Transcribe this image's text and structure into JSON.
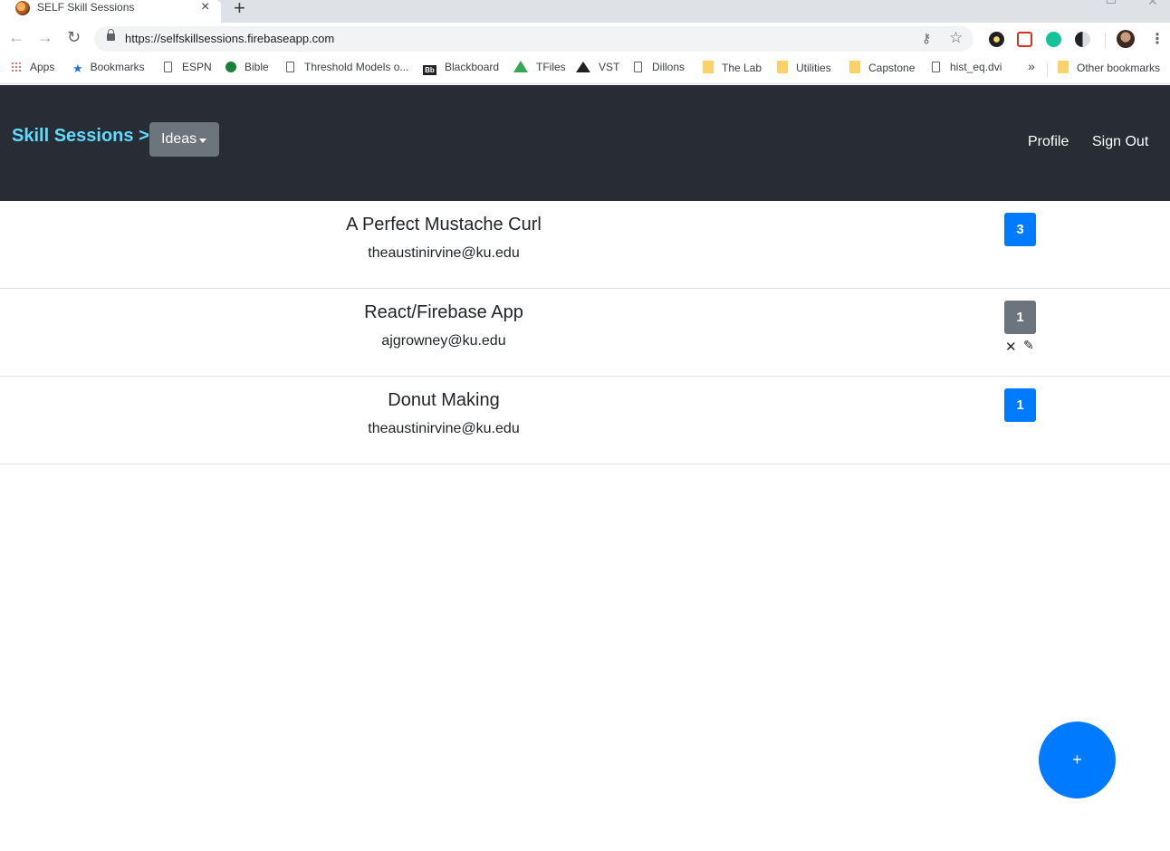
{
  "browser": {
    "tab_title": "SELF Skill Sessions",
    "tab_close": "×",
    "new_tab": "+",
    "url": "https://selfskillsessions.firebaseapp.com",
    "bookmarks": [
      {
        "label": "Apps",
        "icon": "apps-grid-icon"
      },
      {
        "label": "Bookmarks",
        "icon": "star-icon"
      },
      {
        "label": "ESPN",
        "icon": "page-icon"
      },
      {
        "label": "Bible",
        "icon": "globe-icon"
      },
      {
        "label": "Threshold Models o...",
        "icon": "page-icon"
      },
      {
        "label": "Blackboard",
        "icon": "blackboard-icon"
      },
      {
        "label": "TFiles",
        "icon": "google-drive-icon"
      },
      {
        "label": "VST",
        "icon": "vst-icon"
      },
      {
        "label": "Dillons",
        "icon": "page-icon"
      },
      {
        "label": "The Lab",
        "icon": "folder-icon"
      },
      {
        "label": "Utilities",
        "icon": "folder-icon"
      },
      {
        "label": "Capstone",
        "icon": "folder-icon"
      },
      {
        "label": "hist_eq.dvi",
        "icon": "page-icon"
      }
    ],
    "bookmarks_more": "»",
    "other_bookmarks": "Other bookmarks"
  },
  "navbar": {
    "brand": "Skill Sessions > >",
    "dropdown_label": "Ideas",
    "links": {
      "profile": "Profile",
      "sign_out": "Sign Out"
    }
  },
  "ideas": [
    {
      "title": "A Perfect Mustache Curl",
      "email": "theaustinirvine@ku.edu",
      "votes": "3",
      "voted": false
    },
    {
      "title": "React/Firebase App",
      "email": "ajgrowney@ku.edu",
      "votes": "1",
      "voted": true,
      "delete_label": "✕",
      "edit_label": "✎"
    },
    {
      "title": "Donut Making",
      "email": "theaustinirvine@ku.edu",
      "votes": "1",
      "voted": false
    }
  ],
  "fab": {
    "label": "+"
  },
  "colors": {
    "navbar_bg": "#282c34",
    "brand": "#61dafb",
    "primary": "#007bff",
    "secondary": "#6c757d"
  }
}
